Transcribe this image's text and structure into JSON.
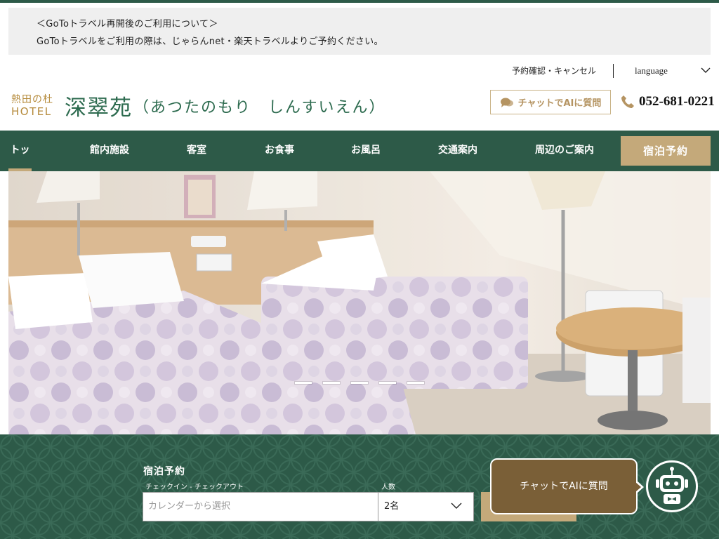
{
  "notice": {
    "line1": "＜GoToトラベル再開後のご利用について＞",
    "line2": "GoToトラベルをご利用の際は、じゃらんnet・楽天トラベルよりご予約ください。"
  },
  "utility": {
    "reservation_link": "予約確認・キャンセル",
    "language_label": "language"
  },
  "logo": {
    "line1": "熱田の杜",
    "line2": "HOTEL",
    "name": "深翠苑",
    "reading": "（あつたのもり　しんすいえん）"
  },
  "header": {
    "chat_button": "チャットでAIに質問",
    "phone": "052-681-0221"
  },
  "nav": {
    "items": [
      {
        "label": "トップ"
      },
      {
        "label": "館内施設"
      },
      {
        "label": "客室"
      },
      {
        "label": "お食事"
      },
      {
        "label": "お風呂"
      },
      {
        "label": "交通案内"
      },
      {
        "label": "周辺のご案内"
      }
    ],
    "book_button": "宿泊予約"
  },
  "booking": {
    "title": "宿泊予約",
    "checkin_label": "チェックイン - チェックアウト",
    "date_placeholder": "カレンダーから選択",
    "guests_label": "人数",
    "guests_value": "2名"
  },
  "chatbot": {
    "bubble_text": "チャットでAIに質問"
  },
  "colors": {
    "brand_green": "#2d5a48",
    "gold": "#c4a97a",
    "chat_brown": "#7a5f37"
  }
}
